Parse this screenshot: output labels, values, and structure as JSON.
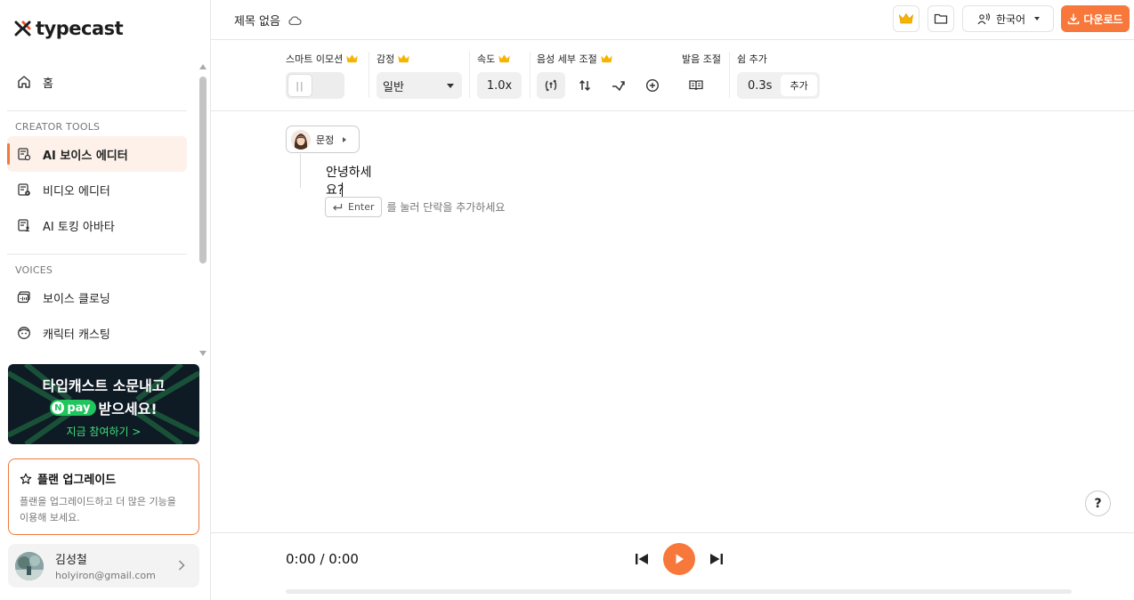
{
  "brand": {
    "logo_text": "typecast"
  },
  "sidebar": {
    "home_label": "홈",
    "section_creator": "CREATOR TOOLS",
    "creator_items": [
      {
        "label": "AI 보이스 에디터",
        "active": true
      },
      {
        "label": "비디오 에디터",
        "active": false
      },
      {
        "label": "AI 토킹 아바타",
        "active": false
      }
    ],
    "section_voices": "VOICES",
    "voice_items": [
      {
        "label": "보이스 클로닝"
      },
      {
        "label": "캐릭터 캐스팅"
      }
    ]
  },
  "banner": {
    "title": "타입캐스트 소문내고",
    "pay_label": "pay",
    "suffix": "받으세요!",
    "cta": "지금 참여하기 >"
  },
  "upgrade": {
    "title": "플랜 업그레이드",
    "description": "플랜을 업그레이드하고 더 많은 기능을 이용해 보세요."
  },
  "user": {
    "name": "김성철",
    "email": "holyiron@gmail.com"
  },
  "header": {
    "doc_title": "제목 없음",
    "language": "한국어",
    "download_label": "다운로드"
  },
  "toolbar": {
    "smart_emotion_label": "스마트 이모션",
    "emotion_label": "감정",
    "emotion_value": "일반",
    "speed_label": "속도",
    "speed_value": "1.0x",
    "voice_detail_label": "음성 세부 조절",
    "pronunciation_label": "발음 조절",
    "rest_label": "쉼 추가",
    "rest_value": "0.3s",
    "rest_add_label": "추가"
  },
  "editor": {
    "speaker_name": "문정",
    "paragraph_text": "안녕하세요?",
    "enter_key_label": "Enter",
    "enter_hint": "를 눌러 단락을 추가하세요",
    "help_label": "?"
  },
  "player": {
    "time": "0:00 / 0:00",
    "progress": 0
  },
  "colors": {
    "accent": "#f8773a",
    "active_bg": "#fdf1ea"
  }
}
